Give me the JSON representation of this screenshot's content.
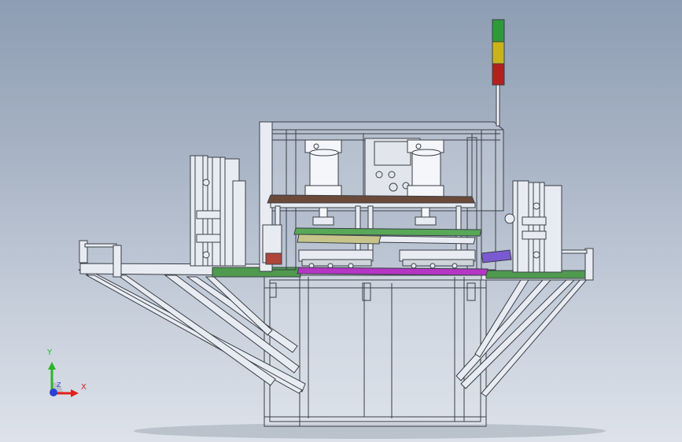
{
  "viewport": {
    "background_top": "#8d9db3",
    "background_bottom": "#dde2ea"
  },
  "model": {
    "frame_color": "#e8ecf2",
    "edge_color": "#3a3f47",
    "accent_green": "#4f9a4f",
    "accent_magenta": "#b535c4",
    "accent_brown": "#6b4a3a",
    "signal_tower": {
      "lights": [
        "#2f9a3a",
        "#c9b318",
        "#b3201c"
      ]
    }
  },
  "triad": {
    "x_label": "X",
    "y_label": "Y",
    "z_label": "Z",
    "x_color": "#e0201a",
    "y_color": "#2ab52a",
    "z_color": "#2a40d8"
  }
}
